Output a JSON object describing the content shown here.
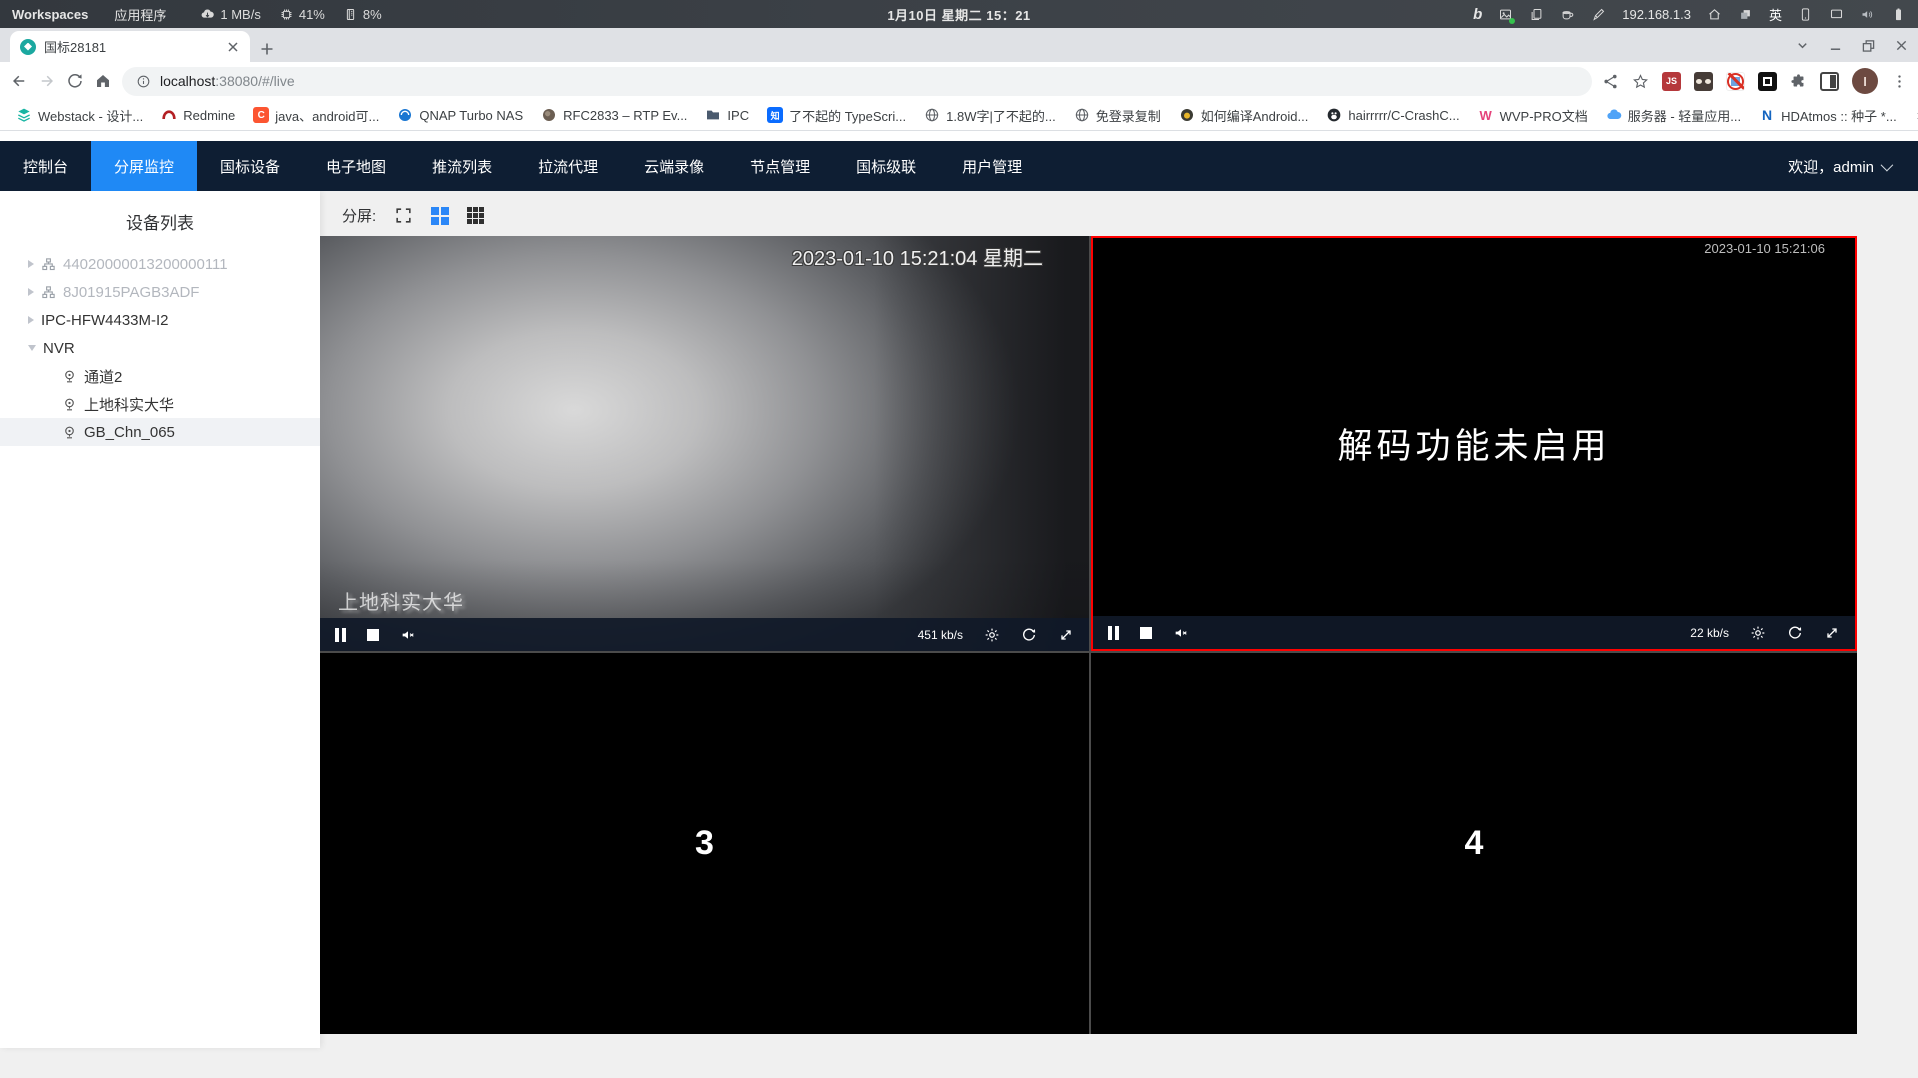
{
  "colors": {
    "accent_blue": "#1f89f5",
    "nav_bg": "#0e1e33",
    "selected_cell_border": "#fe0000",
    "player_bar_bg": "#101928",
    "favicon_teal": "#1ba8a0",
    "sysbar_bg": "#3a3f45"
  },
  "system_bar": {
    "workspaces": "Workspaces",
    "applications": "应用程序",
    "net_speed": "1 MB/s",
    "cpu_usage": "41%",
    "mem_usage": "8%",
    "clock": "1月10日 星期二 15：21",
    "bing_glyph": "b",
    "ip_address": "192.168.1.3",
    "input_lang": "英"
  },
  "browser": {
    "tab_title": "国标28181",
    "url_host": "localhost",
    "url_rest": ":38080/#/live",
    "avatar_letter": "I",
    "js_badge": "JS",
    "bookmarks": [
      {
        "label": "Webstack - 设计..."
      },
      {
        "label": "Redmine"
      },
      {
        "label": "java、android可...",
        "icon_text": "C"
      },
      {
        "label": "QNAP Turbo NAS"
      },
      {
        "label": "RFC2833 – RTP Ev..."
      },
      {
        "label": "IPC"
      },
      {
        "label": "了不起的 TypeScri...",
        "icon_text": "知"
      },
      {
        "label": "1.8W字|了不起的..."
      },
      {
        "label": "免登录复制"
      },
      {
        "label": "如何编译Android..."
      },
      {
        "label": "hairrrrr/C-CrashC..."
      },
      {
        "label": "WVP-PRO文档",
        "icon_text": "W"
      },
      {
        "label": "服务器 - 轻量应用..."
      },
      {
        "label": "HDAtmos :: 种子 *...",
        "icon_text": "N"
      }
    ],
    "bookmarks_overflow": "»"
  },
  "app": {
    "nav_items": [
      {
        "label": "控制台"
      },
      {
        "label": "分屏监控"
      },
      {
        "label": "国标设备"
      },
      {
        "label": "电子地图"
      },
      {
        "label": "推流列表"
      },
      {
        "label": "拉流代理"
      },
      {
        "label": "云端录像"
      },
      {
        "label": "节点管理"
      },
      {
        "label": "国标级联"
      },
      {
        "label": "用户管理"
      }
    ],
    "welcome": "欢迎，admin",
    "sidebar_title": "设备列表",
    "tree": [
      {
        "label": "44020000013200000111"
      },
      {
        "label": "8J01915PAGB3ADF"
      },
      {
        "label": "IPC-HFW4433M-I2"
      },
      {
        "label": "NVR"
      },
      {
        "label": "通道2"
      },
      {
        "label": "上地科实大华"
      },
      {
        "label": "GB_Chn_065"
      }
    ],
    "split_label": "分屏:",
    "cells": {
      "cell1": {
        "timestamp": "2023-01-10 15:21:04 星期二",
        "watermark": "上地科实大华",
        "bitrate": "451 kb/s"
      },
      "cell2": {
        "timestamp": "2023-01-10 15:21:06",
        "message": "解码功能未启用",
        "bitrate": "22 kb/s"
      },
      "cell3": {
        "placeholder": "3"
      },
      "cell4": {
        "placeholder": "4"
      }
    }
  }
}
